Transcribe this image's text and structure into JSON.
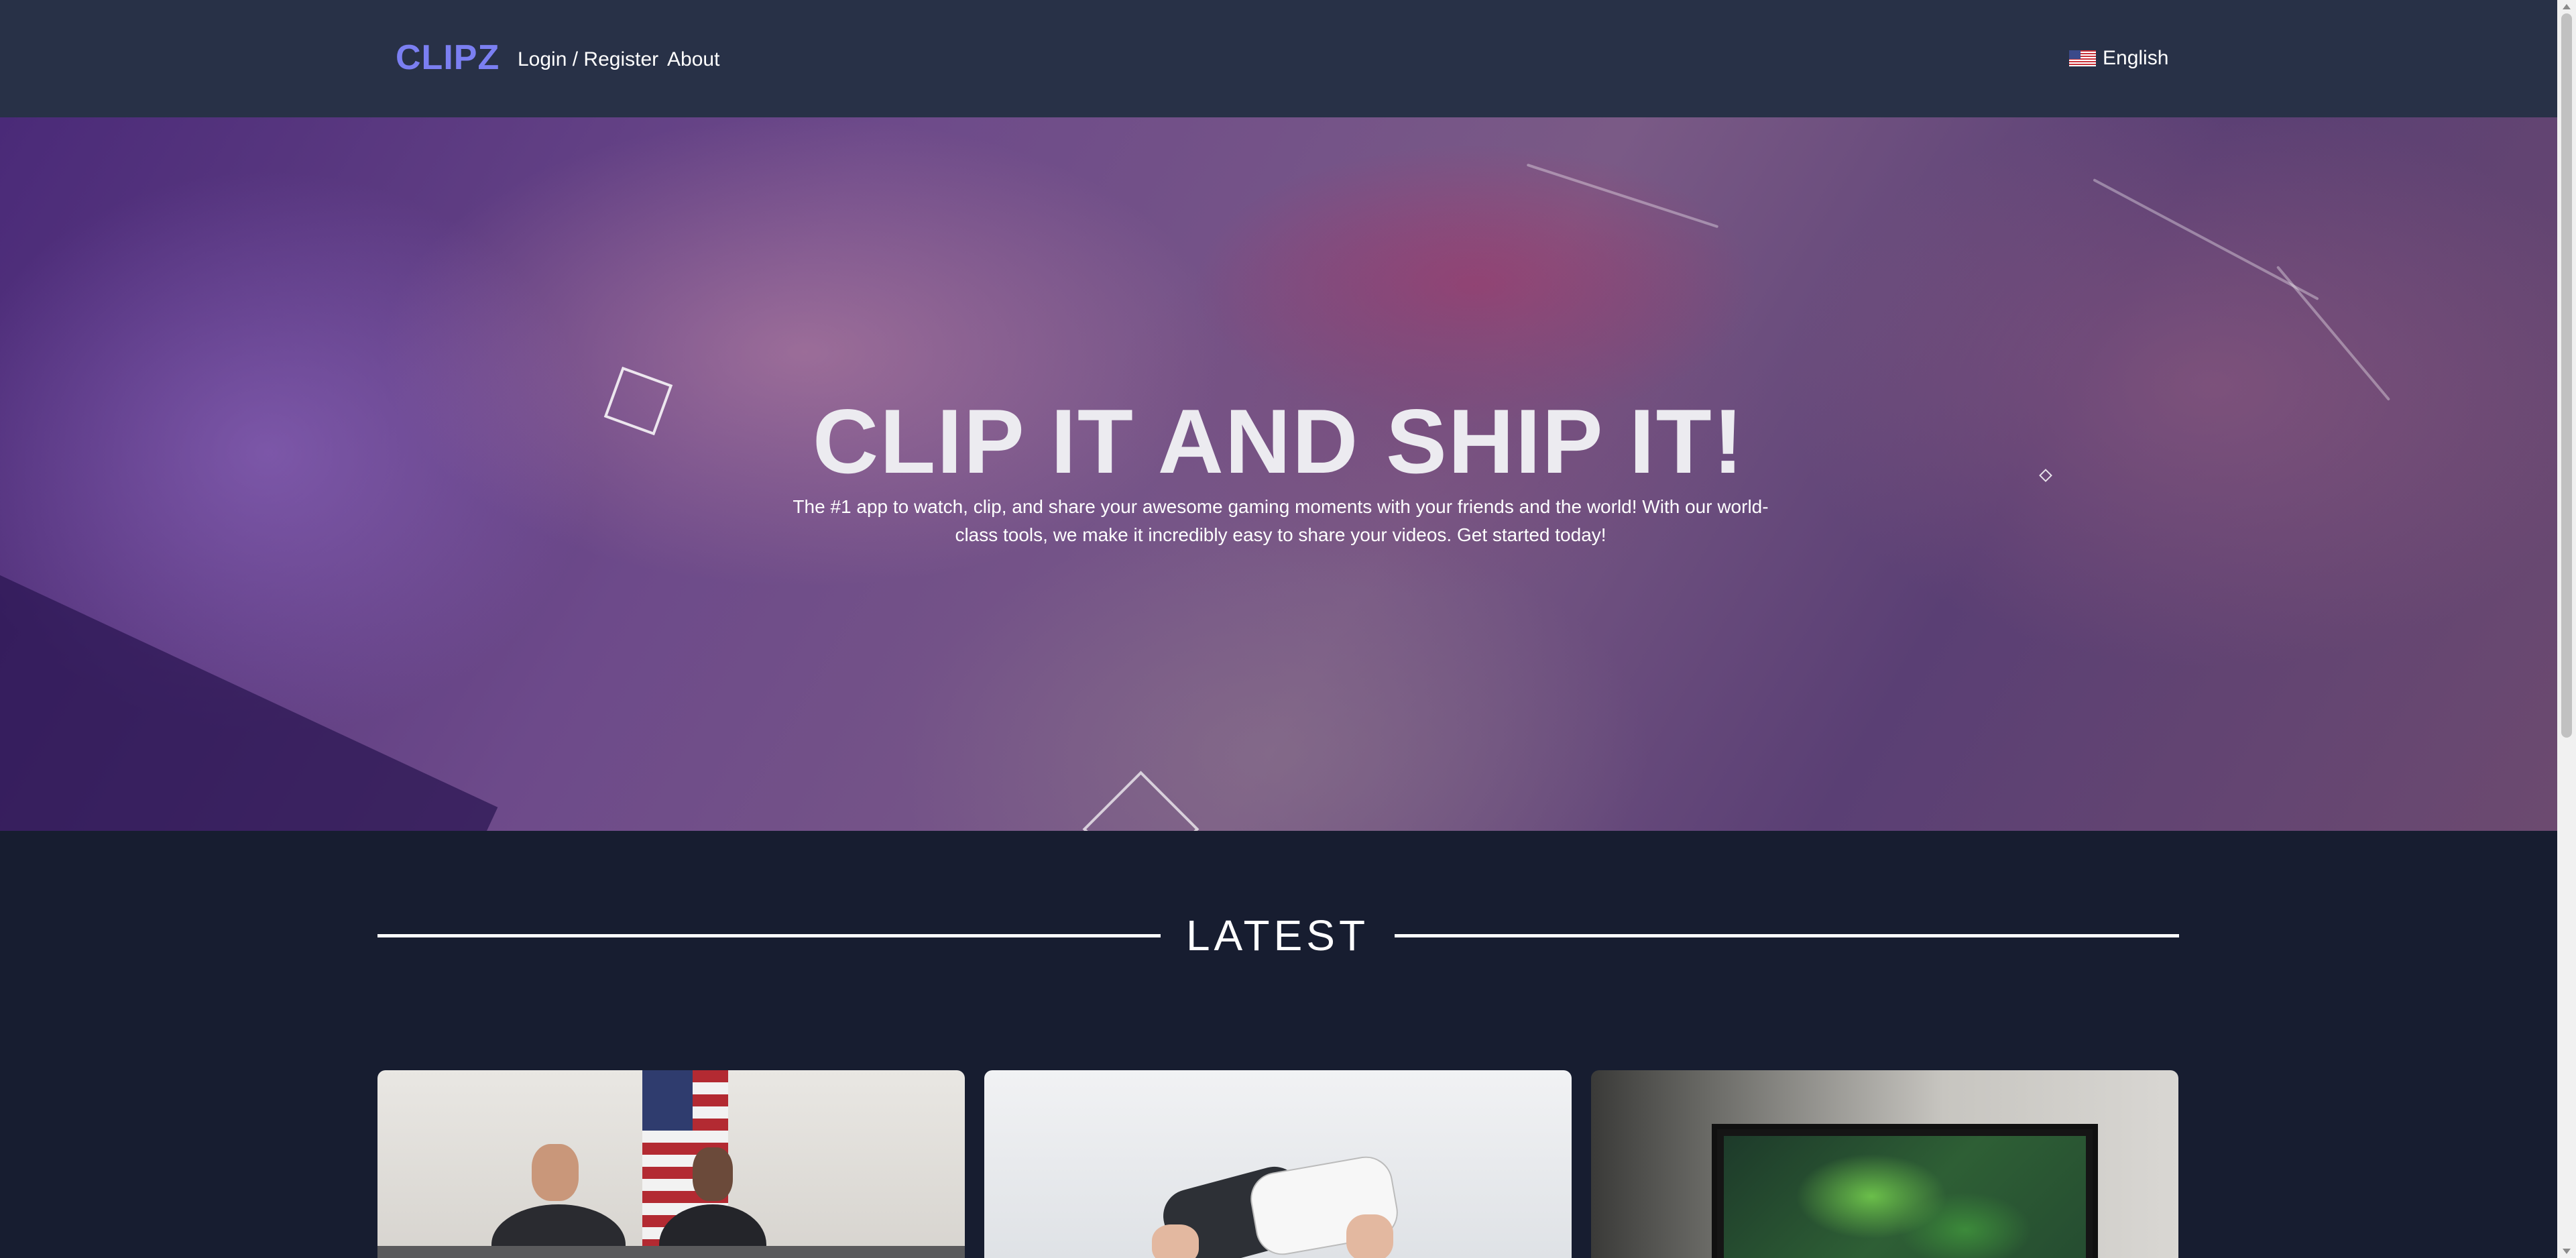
{
  "nav": {
    "logo": "CLIPZ",
    "links": {
      "login": "Login / Register",
      "about": "About"
    },
    "language": "English",
    "language_icon": "us-flag-icon"
  },
  "hero": {
    "title": "CLIP IT AND SHIP IT!",
    "subtitle": "The #1 app to watch, clip, and share your awesome gaming moments with your friends and the world! With our world-class tools, we make it incredibly easy to share your videos. Get started today!"
  },
  "latest": {
    "title": "LATEST"
  },
  "colors": {
    "nav_bg": "#283147",
    "page_bg": "#171d30",
    "logo": "#7b7ff2"
  }
}
